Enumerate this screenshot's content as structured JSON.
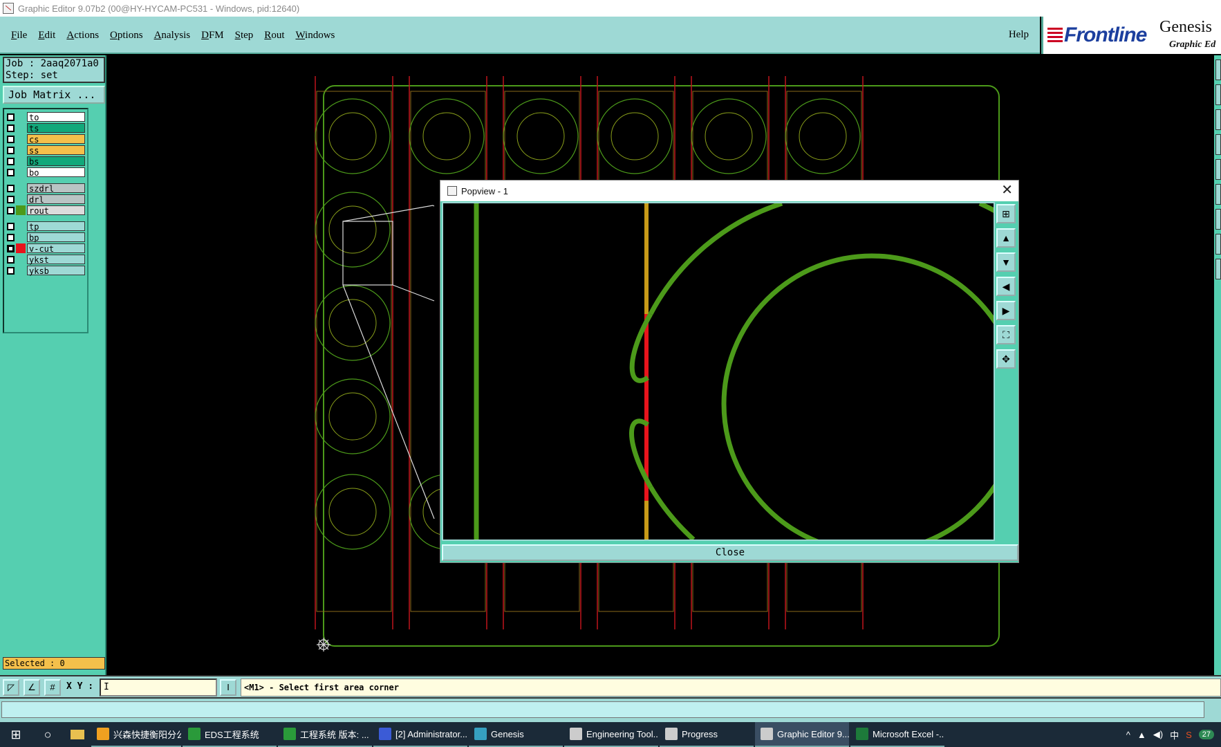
{
  "window": {
    "title": "Graphic Editor 9.07b2 (00@HY-HYCAM-PC531 - Windows, pid:12640)"
  },
  "menubar": {
    "items": [
      "File",
      "Edit",
      "Actions",
      "Options",
      "Analysis",
      "DFM",
      "Step",
      "Rout",
      "Windows"
    ],
    "help": "Help"
  },
  "logo": {
    "brand": "Frontline",
    "product": "Genesis",
    "subtitle": "Graphic Ed"
  },
  "job": {
    "job_line": "Job : 2aaq2071a0",
    "step_line": "Step: set",
    "matrix_button": "Job Matrix ..."
  },
  "layers": [
    {
      "name": "to",
      "color": "#ffffff",
      "swatch": "",
      "checked": false
    },
    {
      "name": "ts",
      "color": "#12a87a",
      "swatch": "",
      "checked": false
    },
    {
      "name": "cs",
      "color": "#f4c04b",
      "swatch": "",
      "checked": false
    },
    {
      "name": "ss",
      "color": "#f4c04b",
      "swatch": "",
      "checked": false
    },
    {
      "name": "bs",
      "color": "#12a87a",
      "swatch": "",
      "checked": false
    },
    {
      "name": "bo",
      "color": "#ffffff",
      "swatch": "",
      "checked": false
    },
    {
      "name": "szdrl",
      "color": "#b9c4c4",
      "swatch": "",
      "checked": false
    },
    {
      "name": "drl",
      "color": "#b9c4c4",
      "swatch": "",
      "checked": false
    },
    {
      "name": "rout",
      "color": "#dcdcdc",
      "swatch": "#4c9a1a",
      "checked": false
    },
    {
      "name": "tp",
      "color": "#9ed9d5",
      "swatch": "",
      "checked": false
    },
    {
      "name": "bp",
      "color": "#9ed9d5",
      "swatch": "",
      "checked": false
    },
    {
      "name": "v-cut",
      "color": "#9ed9d5",
      "swatch": "#e8141c",
      "checked": true
    },
    {
      "name": "ykst",
      "color": "#9ed9d5",
      "swatch": "",
      "checked": false
    },
    {
      "name": "yksb",
      "color": "#9ed9d5",
      "swatch": "",
      "checked": false
    }
  ],
  "selected": "Selected : 0",
  "popview": {
    "title": "Popview - 1",
    "close_label": "Close"
  },
  "status": {
    "xy_label": "X Y :",
    "xy_value": "I",
    "message": "<M1> - Select first area corner"
  },
  "taskbar": {
    "items": [
      {
        "label": "兴森快捷衡阳分公...",
        "color": "#f0a020"
      },
      {
        "label": "EDS工程系统",
        "color": "#2a9a3a"
      },
      {
        "label": "工程系统   版本: ...",
        "color": "#2a9a3a"
      },
      {
        "label": "[2] Administrator...",
        "color": "#3b5bd6"
      },
      {
        "label": "Genesis",
        "color": "#36a0c0"
      },
      {
        "label": "Engineering Tool...",
        "color": "#cccccc"
      },
      {
        "label": "Progress",
        "color": "#cccccc"
      },
      {
        "label": "Graphic Editor 9....",
        "color": "#cccccc"
      },
      {
        "label": "Microsoft Excel -...",
        "color": "#1d7a3a"
      }
    ],
    "tray_ime": "中",
    "clock": "27"
  }
}
